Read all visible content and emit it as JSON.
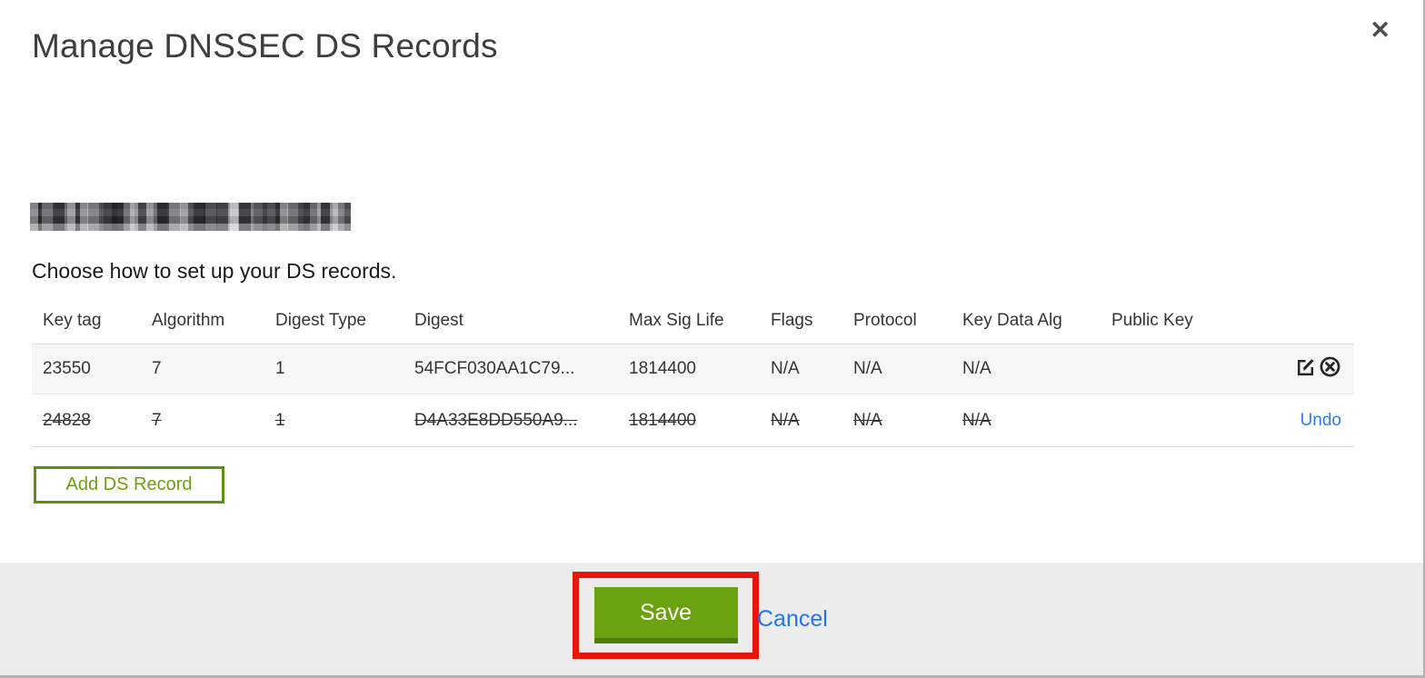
{
  "modal": {
    "title": "Manage DNSSEC DS Records",
    "close_icon": "✕",
    "domain": {
      "redacted": true
    },
    "instruction": "Choose how to set up your DS records.",
    "add_button_label": "Add DS Record"
  },
  "table": {
    "columns": [
      "Key tag",
      "Algorithm",
      "Digest Type",
      "Digest",
      "Max Sig Life",
      "Flags",
      "Protocol",
      "Key Data Alg",
      "Public Key"
    ],
    "rows": [
      {
        "key_tag": "23550",
        "algorithm": "7",
        "digest_type": "1",
        "digest": "54FCF030AA1C79...",
        "max_sig_life": "1814400",
        "flags": "N/A",
        "protocol": "N/A",
        "key_data_alg": "N/A",
        "public_key": "",
        "state": "normal",
        "actions": [
          "edit-icon",
          "delete-icon"
        ]
      },
      {
        "key_tag": "24828",
        "algorithm": "7",
        "digest_type": "1",
        "digest": "D4A33E8DD550A9...",
        "max_sig_life": "1814400",
        "flags": "N/A",
        "protocol": "N/A",
        "key_data_alg": "N/A",
        "public_key": "",
        "state": "deleted",
        "action_label": "Undo"
      }
    ]
  },
  "footer": {
    "save_label": "Save",
    "cancel_label": "Cancel"
  },
  "colors": {
    "save_green": "#6aa30f",
    "save_green_shadow": "#4f7d09",
    "add_button_green": "#5a930b",
    "link_blue": "#2e7bf6",
    "annotation_red": "#ea140a",
    "footer_bg": "#ececec",
    "row_stripe": "#f6f6f6",
    "title_gray": "#3e3e3e"
  }
}
